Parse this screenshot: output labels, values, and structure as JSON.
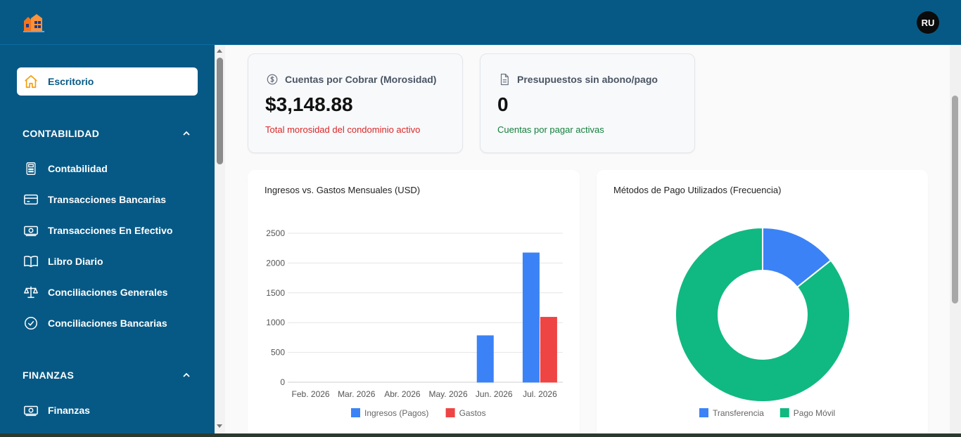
{
  "header": {
    "avatar_initials": "RU",
    "brand_color": "#075985"
  },
  "sidebar": {
    "active_item": {
      "label": "Escritorio",
      "icon": "home-icon"
    },
    "sections": [
      {
        "title": "CONTABILIDAD",
        "items": [
          {
            "label": "Contabilidad",
            "icon": "calculator-icon"
          },
          {
            "label": "Transacciones Bancarias",
            "icon": "credit-card-icon"
          },
          {
            "label": "Transacciones En Efectivo",
            "icon": "cash-icon"
          },
          {
            "label": "Libro Diario",
            "icon": "book-icon"
          },
          {
            "label": "Conciliaciones Generales",
            "icon": "scale-icon"
          },
          {
            "label": "Conciliaciones Bancarias",
            "icon": "check-circle-icon"
          }
        ]
      },
      {
        "title": "FINANZAS",
        "items": [
          {
            "label": "Finanzas",
            "icon": "cash-icon"
          }
        ]
      }
    ]
  },
  "kpis": [
    {
      "title": "Cuentas por Cobrar (Morosidad)",
      "value": "$3,148.88",
      "subtitle": "Total morosidad del condominio activo",
      "subtitle_color": "#dc2626",
      "icon": "dollar-circle-icon"
    },
    {
      "title": "Presupuestos sin abono/pago",
      "value": "0",
      "subtitle": "Cuentas por pagar activas",
      "subtitle_color": "#15803d",
      "icon": "document-icon"
    }
  ],
  "charts": {
    "bar_title": "Ingresos vs. Gastos Mensuales (USD)",
    "pie_title": "Métodos de Pago Utilizados (Frecuencia)"
  },
  "chart_data": [
    {
      "type": "bar",
      "title": "Ingresos vs. Gastos Mensuales (USD)",
      "categories": [
        "Feb. 2026",
        "Mar. 2026",
        "Abr. 2026",
        "May. 2026",
        "Jun. 2026",
        "Jul. 2026"
      ],
      "series": [
        {
          "name": "Ingresos (Pagos)",
          "color": "#3b82f6",
          "values": [
            0,
            0,
            0,
            0,
            780,
            2170
          ]
        },
        {
          "name": "Gastos",
          "color": "#ef4444",
          "values": [
            0,
            0,
            0,
            0,
            0,
            1090
          ]
        }
      ],
      "ylim": [
        0,
        2500
      ],
      "yticks": [
        0,
        500,
        1000,
        1500,
        2000,
        2500
      ],
      "legend": "bottom",
      "grid": true
    },
    {
      "type": "pie",
      "variant": "doughnut",
      "title": "Métodos de Pago Utilizados (Frecuencia)",
      "labels": [
        "Transferencia",
        "Pago Móvil"
      ],
      "values": [
        1,
        6
      ],
      "colors": [
        "#3b82f6",
        "#10b981"
      ],
      "legend": "bottom"
    }
  ]
}
